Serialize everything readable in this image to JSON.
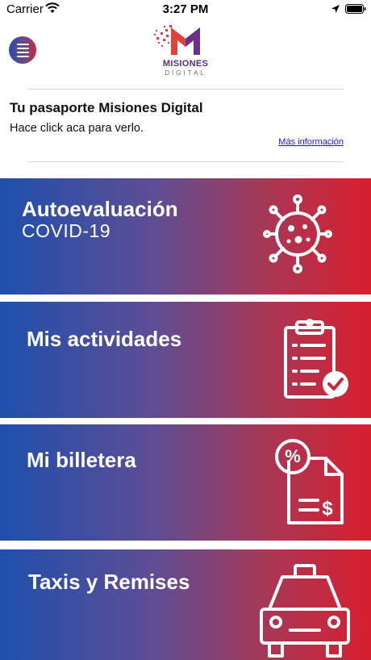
{
  "status_bar": {
    "carrier": "Carrier",
    "time": "3:27 PM"
  },
  "header": {
    "logo_name": "MISIONES",
    "logo_sub": "DIGITAL"
  },
  "passport": {
    "title": "Tu pasaporte Misiones Digital",
    "text": "Hace click aca para verlo.",
    "link": "Más información"
  },
  "tiles": [
    {
      "title": "Autoevaluación",
      "subtitle": "COVID-19",
      "icon": "virus-icon"
    },
    {
      "title": "Mis actividades",
      "icon": "clipboard-check-icon"
    },
    {
      "title": "Mi billetera",
      "icon": "invoice-icon"
    },
    {
      "title": "Taxis y Remises",
      "icon": "taxi-icon"
    }
  ],
  "colors": {
    "gradient_start": "#1f4fae",
    "gradient_end": "#d81f2e",
    "brand_purple": "#5b2b7e",
    "link": "#1a1adc"
  }
}
